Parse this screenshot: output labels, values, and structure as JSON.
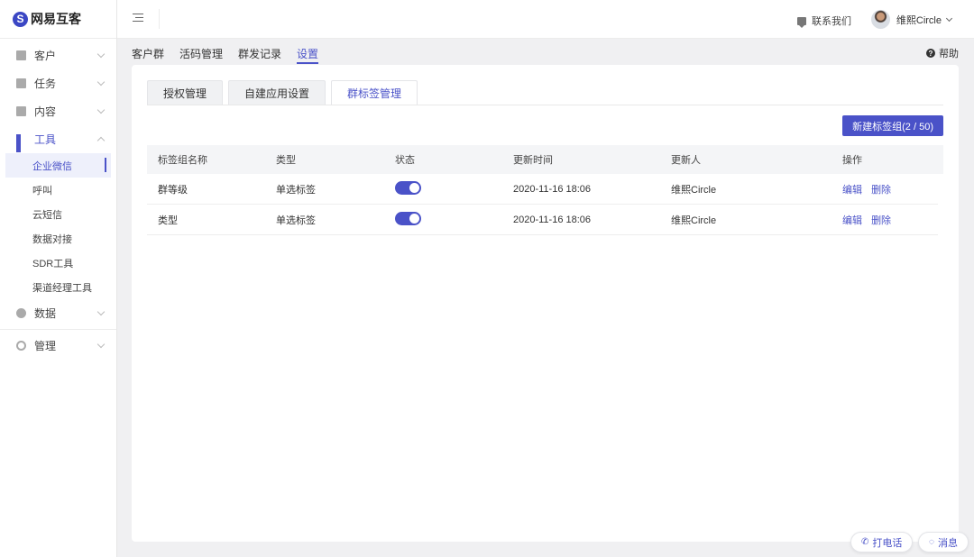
{
  "app": {
    "logo_text": "网易互客"
  },
  "sidebar": {
    "items": [
      {
        "label": "客户",
        "icon": "customer-icon"
      },
      {
        "label": "任务",
        "icon": "task-icon"
      },
      {
        "label": "内容",
        "icon": "content-icon"
      },
      {
        "label": "工具",
        "icon": "tools-icon",
        "children": [
          "企业微信",
          "呼叫",
          "云短信",
          "数据对接",
          "SDR工具",
          "渠道经理工具"
        ]
      },
      {
        "label": "数据",
        "icon": "data-icon"
      },
      {
        "label": "管理",
        "icon": "settings-icon"
      }
    ]
  },
  "topbar": {
    "contact_label": "联系我们",
    "user_name": "维熙Circle"
  },
  "subnav": {
    "tabs": [
      "客户群",
      "活码管理",
      "群发记录",
      "设置"
    ],
    "help_label": "帮助"
  },
  "tabs": [
    "授权管理",
    "自建应用设置",
    "群标签管理"
  ],
  "new_button_label": "新建标签组(2 / 50)",
  "table": {
    "headers": [
      "标签组名称",
      "类型",
      "状态",
      "更新时间",
      "更新人",
      "操作"
    ],
    "rows": [
      {
        "name": "群等级",
        "type": "单选标签",
        "enabled": true,
        "time": "2020-11-16 18:06",
        "user": "维熙Circle"
      },
      {
        "name": "类型",
        "type": "单选标签",
        "enabled": true,
        "time": "2020-11-16 18:06",
        "user": "维熙Circle"
      }
    ],
    "edit_label": "编辑",
    "delete_label": "删除"
  },
  "float": {
    "call_label": "打电话",
    "message_label": "消息"
  },
  "colors": {
    "accent": "#4a52c8",
    "background": "#f0f0f2"
  }
}
